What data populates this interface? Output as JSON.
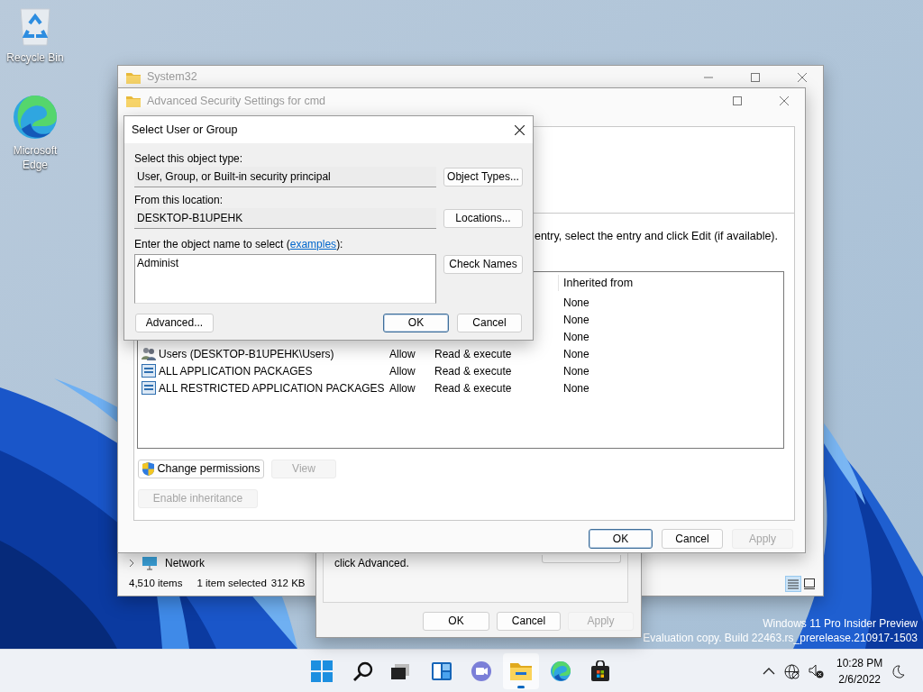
{
  "desktop_icons": [
    {
      "label": "Recycle Bin",
      "kind": "recycle"
    },
    {
      "label": "Microsoft Edge",
      "kind": "edge"
    }
  ],
  "explorer": {
    "title": "System32",
    "nav_item": "Network",
    "status_bar": {
      "item_count": "4,510 items",
      "selection": "1 item selected",
      "size": "312 KB"
    },
    "views": [
      {
        "kind": "details",
        "selected": true
      },
      {
        "kind": "tiles",
        "selected": false
      }
    ]
  },
  "properties": {
    "text": "click Advanced.",
    "buttons": [
      {
        "label": "OK",
        "default": false,
        "disabled": false
      },
      {
        "label": "Cancel",
        "default": false,
        "disabled": false
      },
      {
        "label": "Apply",
        "default": false,
        "disabled": true
      }
    ]
  },
  "security": {
    "title": "Advanced Security Settings for cmd",
    "instruction": "entry, select the entry and click Edit (if available).",
    "columns": [
      {
        "label": "Inherited from"
      }
    ],
    "entries": [
      {
        "inherited_from": "None"
      },
      {
        "inherited_from": "None"
      },
      {
        "inherited_from": "None"
      },
      {
        "kind": "group",
        "principal": "Users (DESKTOP-B1UPEHK\\Users)",
        "type": "Allow",
        "access": "Read & execute",
        "inherited_from": "None"
      },
      {
        "kind": "package",
        "principal": "ALL APPLICATION PACKAGES",
        "type": "Allow",
        "access": "Read & execute",
        "inherited_from": "None"
      },
      {
        "kind": "package",
        "principal": "ALL RESTRICTED APPLICATION PACKAGES",
        "type": "Allow",
        "access": "Read & execute",
        "inherited_from": "None"
      }
    ],
    "actions": [
      {
        "label": "Change permissions",
        "kind": "shield",
        "disabled": false
      },
      {
        "label": "View",
        "kind": "plain",
        "disabled": true
      }
    ],
    "inheritance_button": {
      "label": "Enable inheritance",
      "disabled": true
    },
    "buttons": [
      {
        "label": "OK",
        "default": true,
        "disabled": false
      },
      {
        "label": "Cancel",
        "default": false,
        "disabled": false
      },
      {
        "label": "Apply",
        "default": false,
        "disabled": true
      }
    ]
  },
  "select_dialog": {
    "title": "Select User or Group",
    "object_type_label": "Select this object type:",
    "object_type": "User, Group, or Built-in security principal",
    "object_types_button": "Object Types...",
    "location_label": "From this location:",
    "location": "DESKTOP-B1UPEHK",
    "locations_button": "Locations...",
    "name_label": "Enter the object name to select (",
    "name_link": "examples",
    "name_label_end": "):",
    "name_value": "Administ",
    "check_names_button": "Check Names",
    "advanced_button": "Advanced...",
    "buttons": [
      {
        "label": "OK",
        "default": true
      },
      {
        "label": "Cancel",
        "default": false
      }
    ]
  },
  "watermark": [
    "Windows 11 Pro Insider Preview",
    "Evaluation copy. Build 22463.rs_prerelease.210917-1503"
  ],
  "taskbar": {
    "apps": [
      {
        "kind": "start",
        "selected": false
      },
      {
        "kind": "search",
        "selected": false
      },
      {
        "kind": "task-view",
        "selected": false
      },
      {
        "kind": "widgets",
        "selected": false
      },
      {
        "kind": "chat",
        "selected": false
      },
      {
        "kind": "explorer",
        "selected": true
      },
      {
        "kind": "edge",
        "selected": false
      },
      {
        "kind": "store",
        "selected": false
      }
    ],
    "time": "10:28 PM",
    "date": "2/6/2022"
  }
}
